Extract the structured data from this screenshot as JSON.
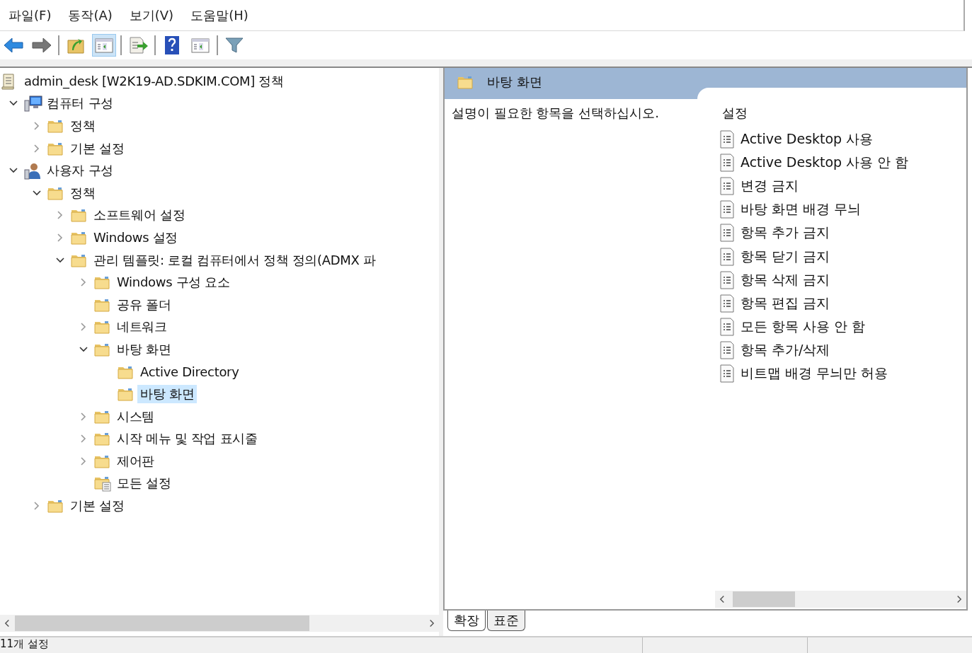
{
  "menu": [
    {
      "label": "파일(F)"
    },
    {
      "label": "동작(A)"
    },
    {
      "label": "보기(V)"
    },
    {
      "label": "도움말(H)"
    }
  ],
  "toolbar": [
    {
      "kind": "back"
    },
    {
      "kind": "forward"
    },
    {
      "kind": "sep"
    },
    {
      "kind": "up"
    },
    {
      "kind": "panel",
      "selected": true
    },
    {
      "kind": "sep"
    },
    {
      "kind": "export"
    },
    {
      "kind": "sep"
    },
    {
      "kind": "help"
    },
    {
      "kind": "panel",
      "selected": false
    },
    {
      "kind": "sep"
    },
    {
      "kind": "filter"
    }
  ],
  "tree": {
    "label": "admin_desk [W2K19-AD.SDKIM.COM] 정책",
    "kind": "policy",
    "selected": false,
    "children": [
      {
        "label": "컴퓨터 구성",
        "kind": "computer",
        "expanded": true,
        "selected": false,
        "children": [
          {
            "label": "정책",
            "kind": "folder",
            "expanded": false,
            "selected": false
          },
          {
            "label": "기본 설정",
            "kind": "folder",
            "expanded": false,
            "selected": false
          }
        ]
      },
      {
        "label": "사용자 구성",
        "kind": "user",
        "expanded": true,
        "selected": false,
        "children": [
          {
            "label": "정책",
            "kind": "folder",
            "expanded": true,
            "selected": false,
            "children": [
              {
                "label": "소프트웨어 설정",
                "kind": "folder",
                "expanded": false,
                "selected": false
              },
              {
                "label": "Windows 설정",
                "kind": "folder",
                "expanded": false,
                "selected": false
              },
              {
                "label": "관리 템플릿: 로컬 컴퓨터에서 정책 정의(ADMX 파",
                "kind": "folder",
                "expanded": true,
                "selected": false,
                "children": [
                  {
                    "label": "Windows 구성 요소",
                    "kind": "folder",
                    "expanded": false,
                    "selected": false
                  },
                  {
                    "label": "공유 폴더",
                    "kind": "folder",
                    "selected": false
                  },
                  {
                    "label": "네트워크",
                    "kind": "folder",
                    "expanded": false,
                    "selected": false
                  },
                  {
                    "label": "바탕 화면",
                    "kind": "folder",
                    "expanded": true,
                    "selected": false,
                    "children": [
                      {
                        "label": "Active Directory",
                        "kind": "folder",
                        "selected": false
                      },
                      {
                        "label": "바탕 화면",
                        "kind": "folder",
                        "selected": true
                      }
                    ]
                  },
                  {
                    "label": "시스템",
                    "kind": "folder",
                    "expanded": false,
                    "selected": false
                  },
                  {
                    "label": "시작 메뉴 및 작업 표시줄",
                    "kind": "folder",
                    "expanded": false,
                    "selected": false
                  },
                  {
                    "label": "제어판",
                    "kind": "folder",
                    "expanded": false,
                    "selected": false
                  },
                  {
                    "label": "모든 설정",
                    "kind": "settings",
                    "selected": false
                  }
                ]
              }
            ]
          },
          {
            "label": "기본 설정",
            "kind": "folder",
            "expanded": false,
            "selected": false
          }
        ]
      }
    ]
  },
  "details": {
    "title": "바탕 화면",
    "description": "설명이 필요한 항목을 선택하십시오.",
    "column": "설정",
    "settings": [
      "Active Desktop 사용",
      "Active Desktop 사용 안 함",
      "변경 금지",
      "바탕 화면 배경 무늬",
      "항목 추가 금지",
      "항목 닫기 금지",
      "항목 삭제 금지",
      "항목 편집 금지",
      "모든 항목 사용 안 함",
      "항목 추가/삭제",
      "비트맵 배경 무늬만 허용"
    ]
  },
  "tabs": [
    {
      "label": "확장",
      "selected": true
    },
    {
      "label": "표준",
      "selected": false
    }
  ],
  "status_bar": {
    "text": "11개 설정"
  }
}
